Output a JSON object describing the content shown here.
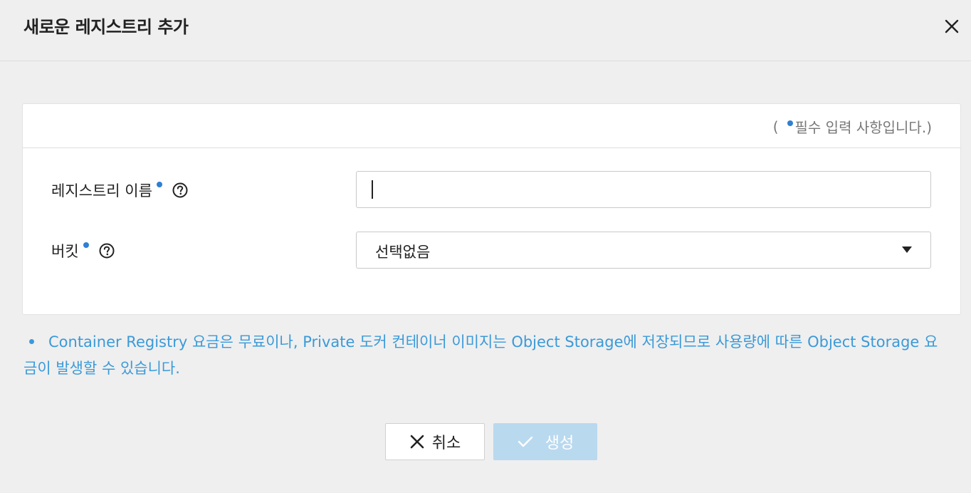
{
  "dialog": {
    "title": "새로운 레지스트리 추가"
  },
  "form": {
    "required_note_open": "(",
    "required_note_text": "필수 입력 사항입니다.)",
    "registry_name": {
      "label": "레지스트리 이름",
      "value": "",
      "placeholder": ""
    },
    "bucket": {
      "label": "버킷",
      "selected": "선택없음"
    }
  },
  "notice": {
    "text": "Container Registry 요금은 무료이나, Private 도커 컨테이너 이미지는 Object Storage에 저장되므로 사용량에 따른 Object Storage 요금이 발생할 수 있습니다."
  },
  "buttons": {
    "cancel": "취소",
    "create": "생성"
  },
  "colors": {
    "accent": "#2f7fd3",
    "notice": "#3a9ad9",
    "create_disabled": "#b9d9ef",
    "background": "#efefef"
  },
  "icons": {
    "close": "close-icon",
    "help": "help-circle-icon",
    "dropdown": "caret-down-icon",
    "cancel": "x-icon",
    "create": "check-icon"
  }
}
